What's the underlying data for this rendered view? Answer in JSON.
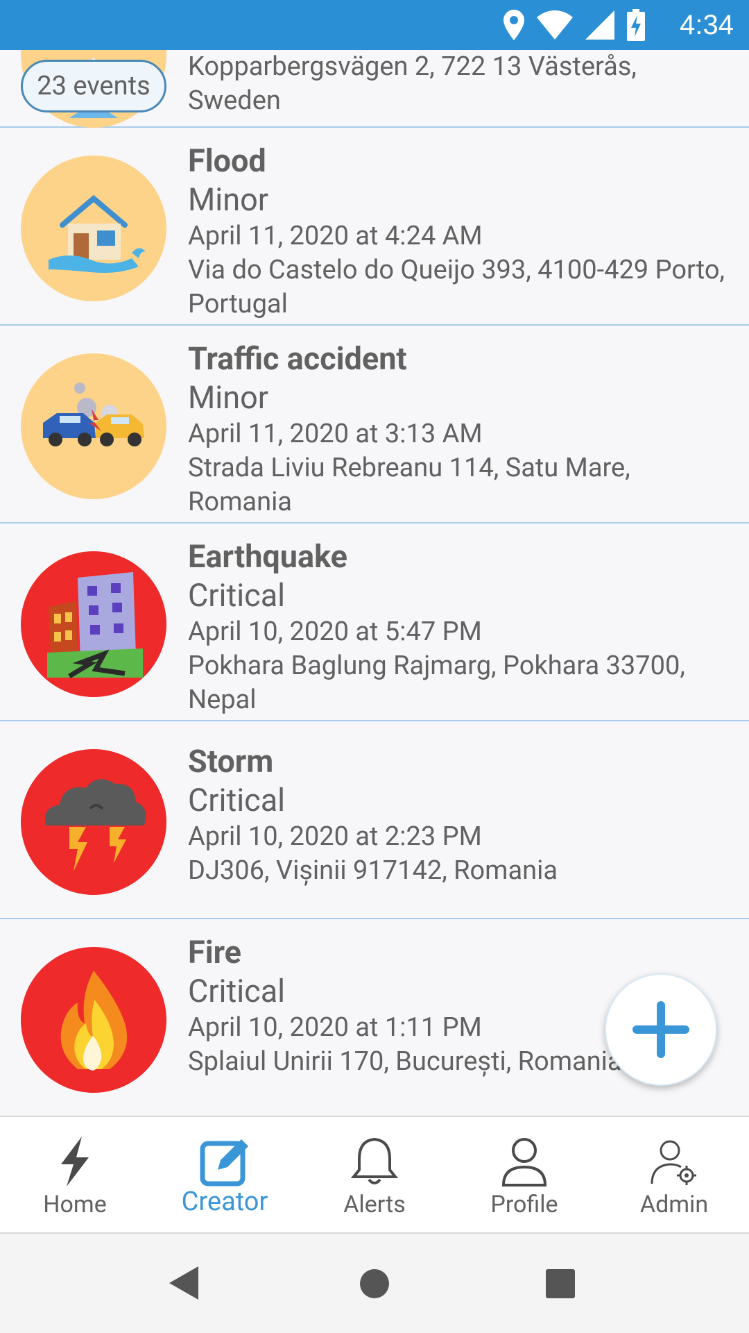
{
  "status_bar": {
    "time": "4:34"
  },
  "partial_event": {
    "badge": "23 events",
    "address": "Kopparbergsvägen 2, 722 13 Västerås, Sweden"
  },
  "events": [
    {
      "title": "Flood",
      "severity": "Minor",
      "date": "April 11, 2020 at 4:24 AM",
      "address": "Via do Castelo do Queijo 393, 4100-429 Porto, Portugal",
      "icon": "flood-icon",
      "color": "#fdd38a"
    },
    {
      "title": "Traffic accident",
      "severity": "Minor",
      "date": "April 11, 2020 at 3:13 AM",
      "address": "Strada Liviu Rebreanu 114, Satu Mare, Romania",
      "icon": "car-crash-icon",
      "color": "#fdd38a"
    },
    {
      "title": "Earthquake",
      "severity": "Critical",
      "date": "April 10, 2020 at 5:47 PM",
      "address": "Pokhara Baglung Rajmarg, Pokhara 33700, Nepal",
      "icon": "earthquake-icon",
      "color": "#ee2a2a"
    },
    {
      "title": "Storm",
      "severity": "Critical",
      "date": "April 10, 2020 at 2:23 PM",
      "address": "DJ306, Vișinii 917142, Romania",
      "icon": "storm-icon",
      "color": "#ee2a2a"
    },
    {
      "title": "Fire",
      "severity": "Critical",
      "date": "April 10, 2020 at 1:11 PM",
      "address": "Splaiul Unirii 170, București, Romania",
      "icon": "fire-icon",
      "color": "#ee2a2a"
    }
  ],
  "bottom_nav": {
    "home": "Home",
    "creator": "Creator",
    "alerts": "Alerts",
    "profile": "Profile",
    "admin": "Admin"
  },
  "colors": {
    "accent": "#3a96d6",
    "status_bar": "#2b8fd6",
    "divider": "#a9cde9"
  }
}
